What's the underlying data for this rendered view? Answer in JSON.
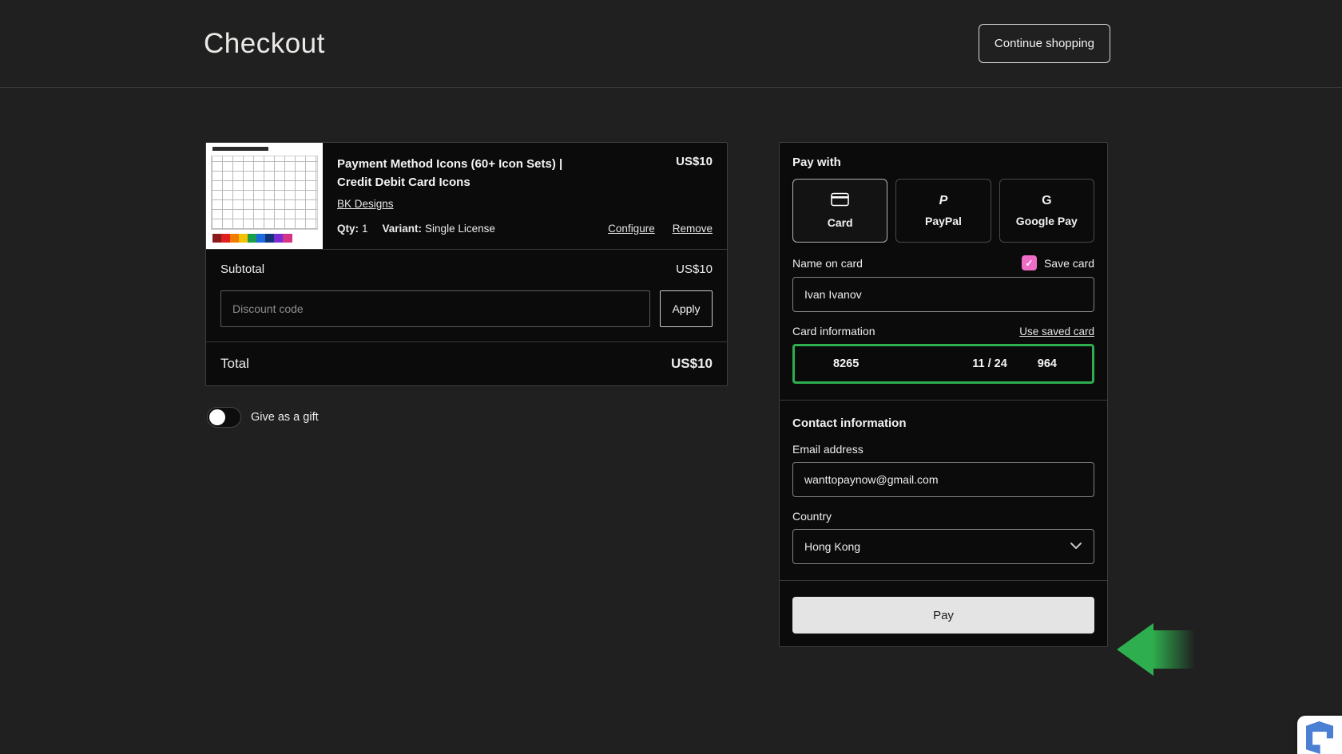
{
  "header": {
    "title": "Checkout",
    "continue_shopping_label": "Continue shopping"
  },
  "cart": {
    "product": {
      "title": "Payment Method Icons (60+ Icon Sets) | Credit Debit Card Icons",
      "price": "US$10",
      "seller_link": "BK Designs",
      "qty_label": "Qty:",
      "qty_value": "1",
      "variant_label": "Variant:",
      "variant_value": "Single License",
      "configure_link": "Configure",
      "remove_link": "Remove"
    },
    "subtotal_label": "Subtotal",
    "subtotal_value": "US$10",
    "discount_placeholder": "Discount code",
    "apply_label": "Apply",
    "total_label": "Total",
    "total_value": "US$10",
    "gift_toggle_label": "Give as a gift",
    "gift_toggle_state": "off"
  },
  "payment": {
    "section_title": "Pay with",
    "methods": [
      {
        "label": "Card",
        "selected": true
      },
      {
        "label": "PayPal",
        "selected": false
      },
      {
        "label": "Google Pay",
        "selected": false
      }
    ],
    "name_on_card_label": "Name on card",
    "save_card_label": "Save card",
    "save_card_checked": true,
    "name_on_card_value": "Ivan Ivanov",
    "card_information_label": "Card information",
    "use_saved_card_link": "Use saved card",
    "card_number_value": "8265",
    "card_expiry_value": "11 / 24",
    "card_cvc_value": "964",
    "contact_section_title": "Contact information",
    "email_label": "Email address",
    "email_value": "wanttopaynow@gmail.com",
    "country_label": "Country",
    "country_value": "Hong Kong",
    "pay_button_label": "Pay"
  },
  "icons": {
    "check": "✓",
    "paypal_glyph": "P",
    "gpay_glyph": "G"
  },
  "colors": {
    "highlight_green": "#2eae4e",
    "save_card_pink": "#f06dc5",
    "pay_button_bg": "#e4e4e4"
  }
}
